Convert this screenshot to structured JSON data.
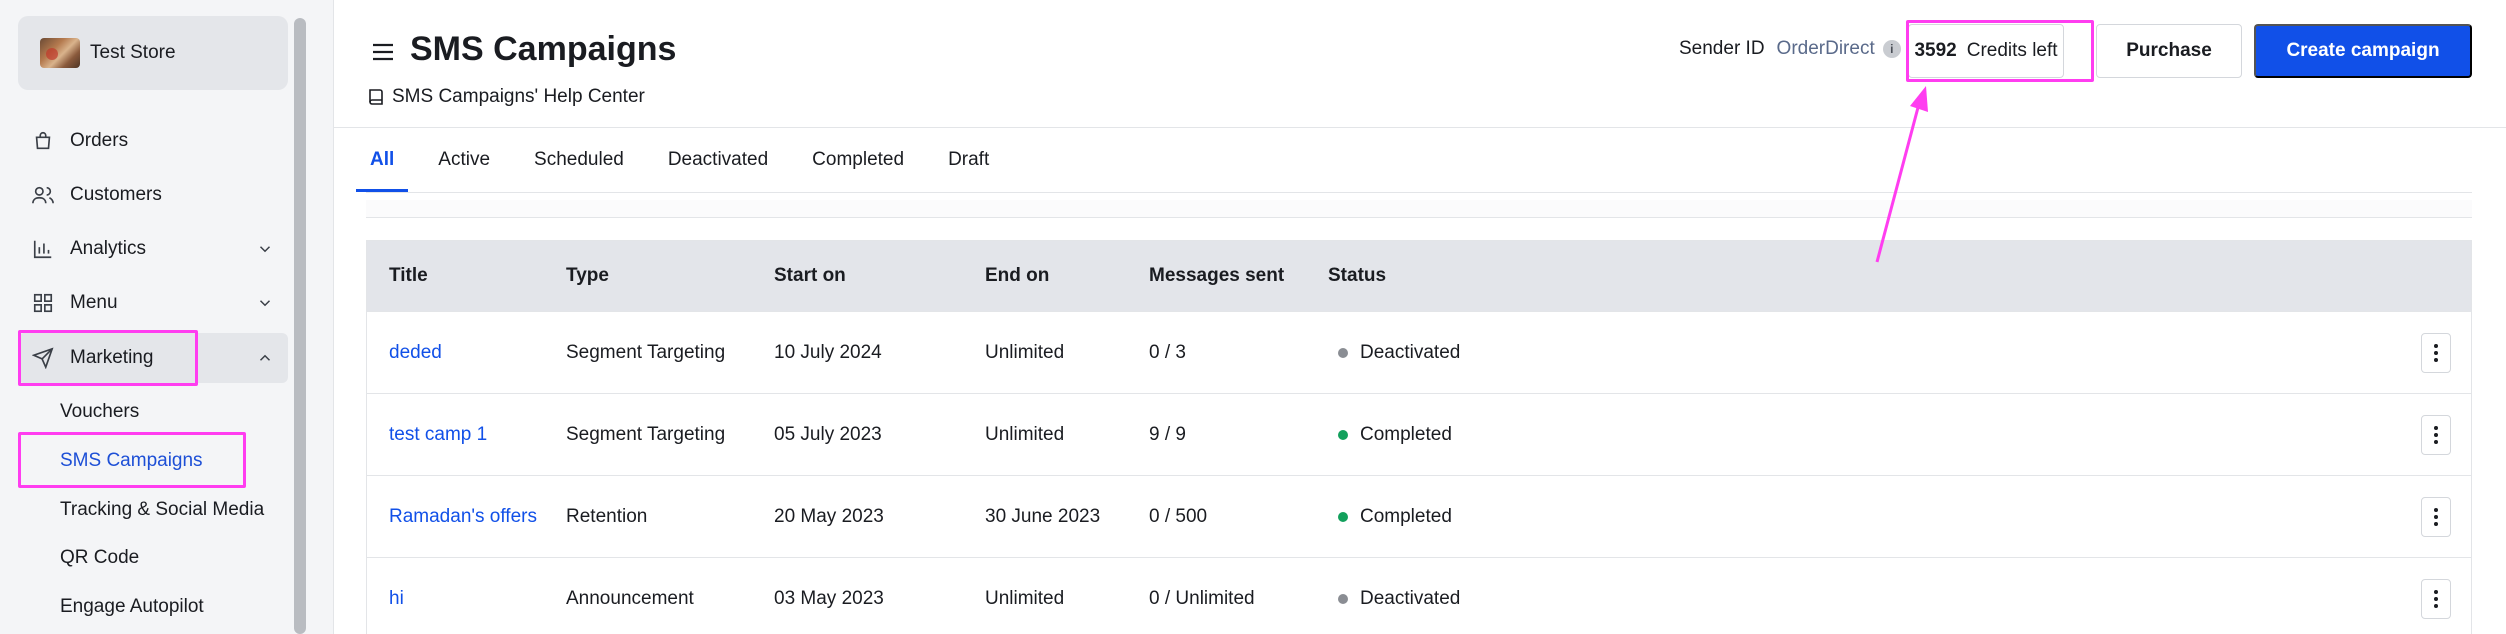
{
  "store": {
    "name": "Test Store"
  },
  "sidebar": {
    "items": [
      {
        "label": "Orders"
      },
      {
        "label": "Customers"
      },
      {
        "label": "Analytics"
      },
      {
        "label": "Menu"
      },
      {
        "label": "Marketing"
      }
    ],
    "marketing_sub": [
      {
        "label": "Vouchers"
      },
      {
        "label": "SMS Campaigns"
      },
      {
        "label": "Tracking & Social Media"
      },
      {
        "label": "QR Code"
      },
      {
        "label": "Engage Autopilot"
      }
    ]
  },
  "header": {
    "title": "SMS Campaigns",
    "help_link": "SMS Campaigns' Help Center",
    "sender_label": "Sender ID",
    "sender_value": "OrderDirect",
    "info_glyph": "i",
    "credits_number": "3592",
    "credits_label": "Credits left",
    "purchase_label": "Purchase",
    "create_label": "Create campaign"
  },
  "tabs": [
    {
      "label": "All"
    },
    {
      "label": "Active"
    },
    {
      "label": "Scheduled"
    },
    {
      "label": "Deactivated"
    },
    {
      "label": "Completed"
    },
    {
      "label": "Draft"
    }
  ],
  "table": {
    "columns": [
      "Title",
      "Type",
      "Start on",
      "End on",
      "Messages sent",
      "Status"
    ],
    "rows": [
      {
        "title": "deded",
        "type": "Segment Targeting",
        "start": "10 July 2024",
        "end": "Unlimited",
        "sent": "0 / 3",
        "status": "Deactivated",
        "status_color": "#8a8d93"
      },
      {
        "title": "test camp 1",
        "type": "Segment Targeting",
        "start": "05 July 2023",
        "end": "Unlimited",
        "sent": "9 / 9",
        "status": "Completed",
        "status_color": "#12a05c"
      },
      {
        "title": "Ramadan's offers",
        "type": "Retention",
        "start": "20 May 2023",
        "end": "30 June 2023",
        "sent": "0 / 500",
        "status": "Completed",
        "status_color": "#12a05c"
      },
      {
        "title": "hi",
        "type": "Announcement",
        "start": "03 May 2023",
        "end": "Unlimited",
        "sent": "0 / Unlimited",
        "status": "Deactivated",
        "status_color": "#8a8d93"
      }
    ]
  },
  "colors": {
    "accent": "#1150e8",
    "annotation": "#ff3df0"
  }
}
